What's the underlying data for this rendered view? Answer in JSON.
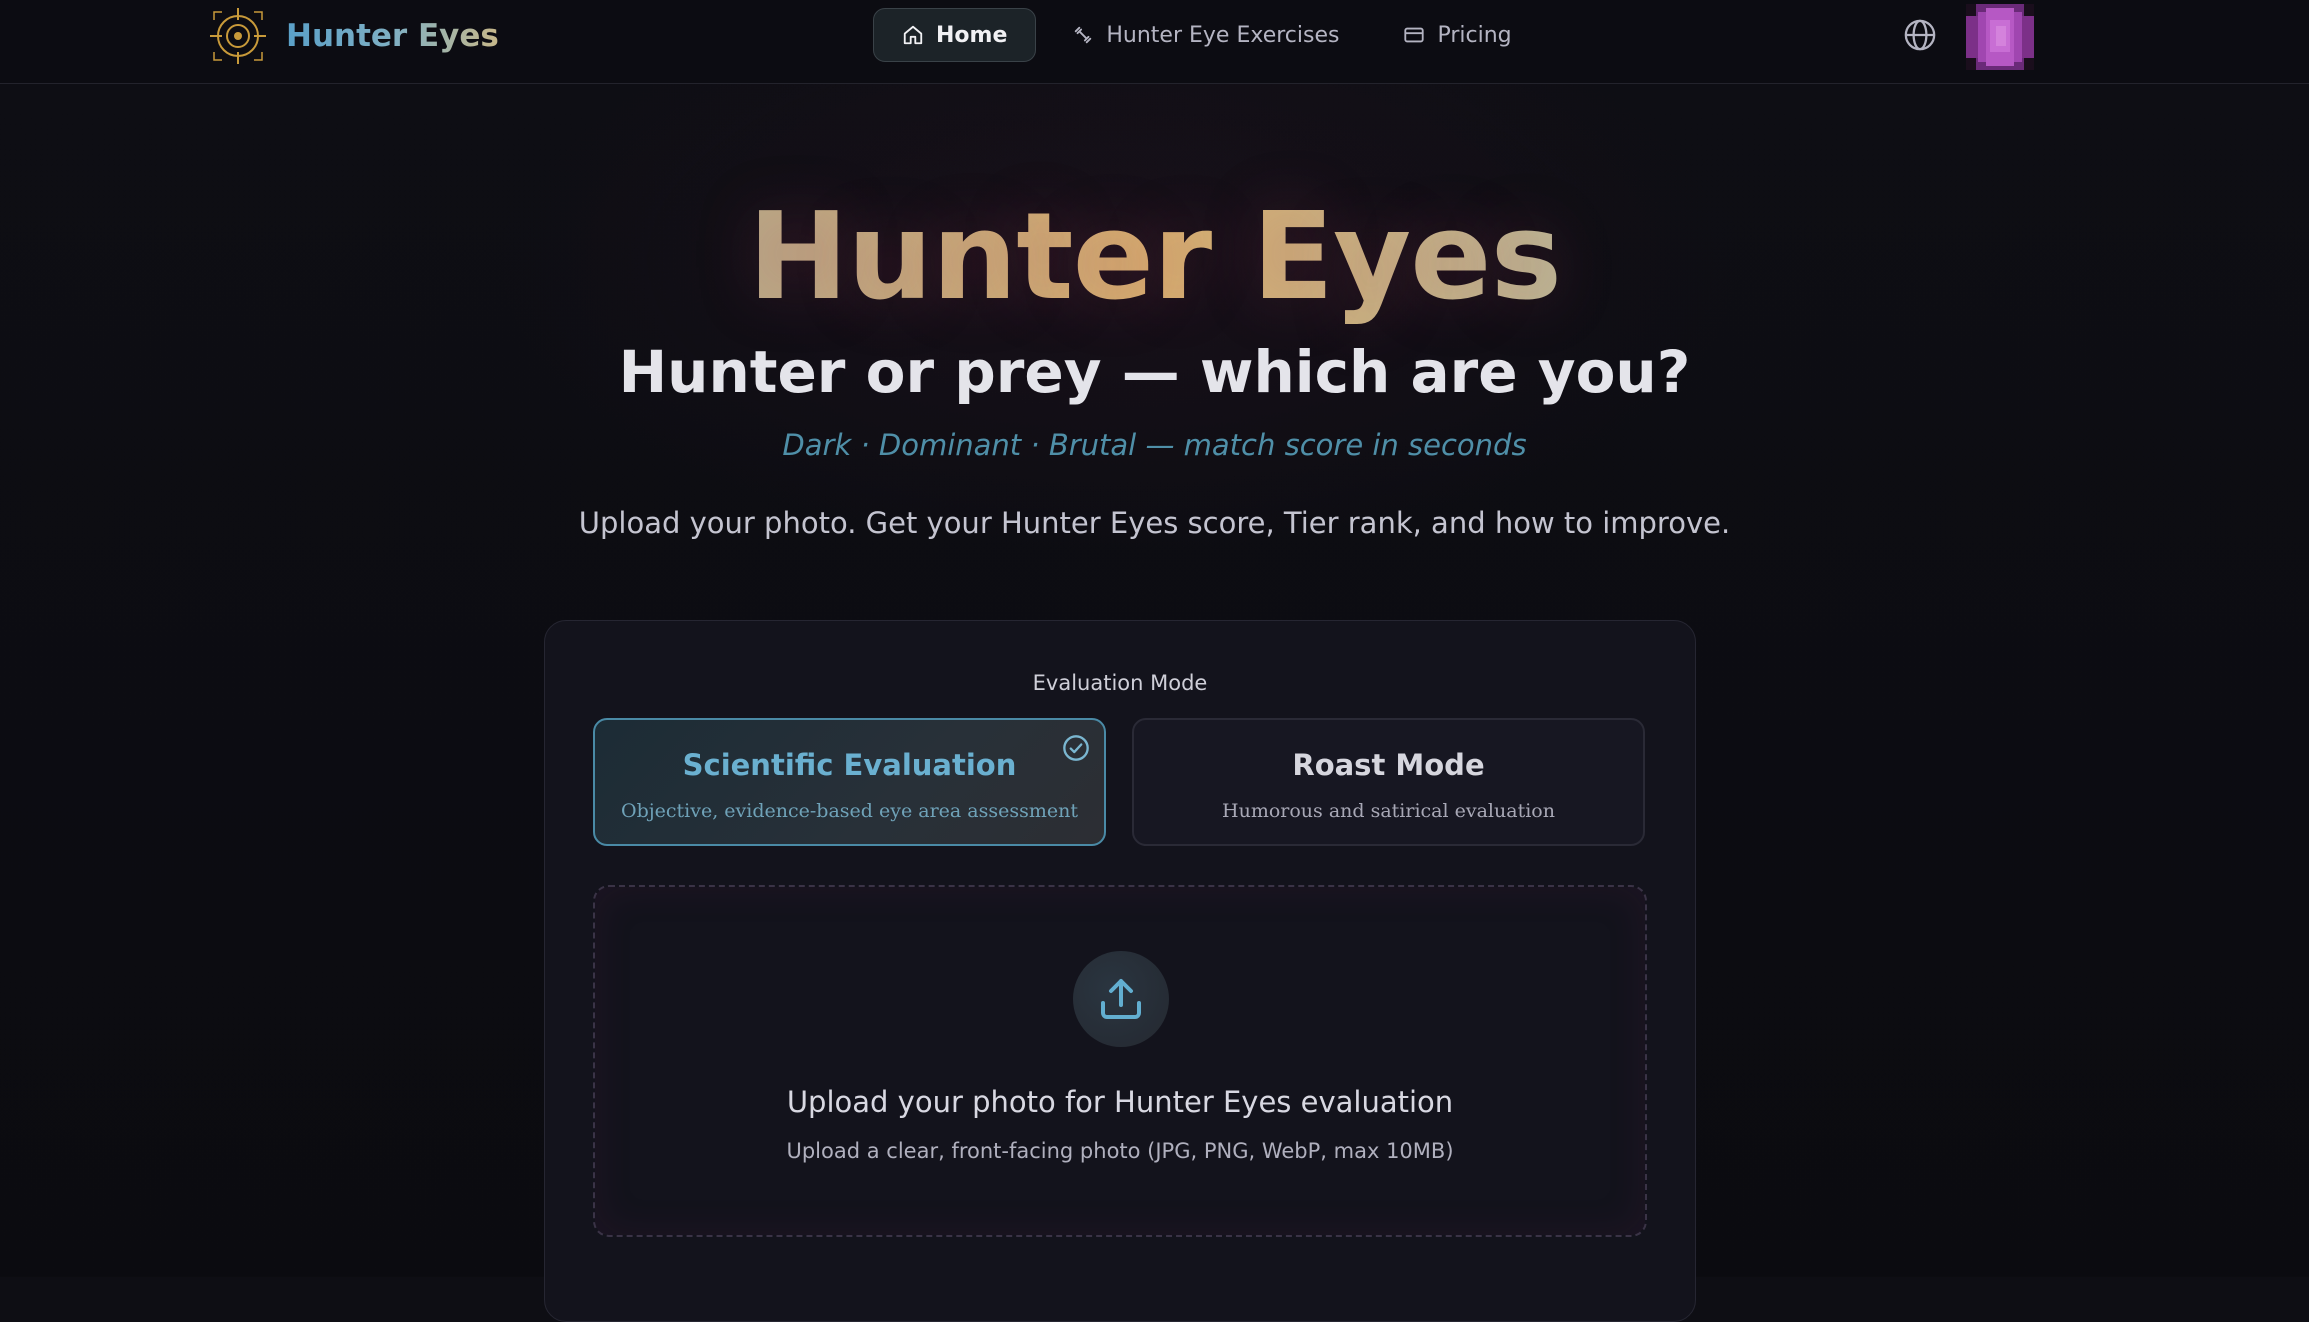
{
  "nav": {
    "brand": "Hunter Eyes",
    "brand_icon": "crosshair-logo-icon",
    "links": [
      {
        "label": "Home",
        "icon": "home-icon",
        "active": true
      },
      {
        "label": "Hunter Eye Exercises",
        "icon": "exercise-icon",
        "active": false
      },
      {
        "label": "Pricing",
        "icon": "card-icon",
        "active": false
      }
    ],
    "language_icon": "globe-icon",
    "avatar": "user-avatar-pixelated"
  },
  "hero": {
    "title": "Hunter Eyes",
    "subtitle": "Hunter or prey — which are you?",
    "tagline": "Dark · Dominant · Brutal — match score in seconds",
    "description": "Upload your photo. Get your Hunter Eyes score, Tier rank, and how to improve."
  },
  "evaluation": {
    "label": "Evaluation Mode",
    "modes": [
      {
        "title": "Scientific Evaluation",
        "description": "Objective, evidence-based eye area assessment",
        "selected": true
      },
      {
        "title": "Roast Mode",
        "description": "Humorous and satirical evaluation",
        "selected": false
      }
    ]
  },
  "upload": {
    "icon": "upload-icon",
    "title": "Upload your photo for Hunter Eyes evaluation",
    "hint": "Upload a clear, front-facing photo (JPG, PNG, WebP, max 10MB)"
  },
  "colors": {
    "background": "#0d0d13",
    "accent_blue": "#4a8aa6",
    "accent_gold": "#d8b070"
  }
}
